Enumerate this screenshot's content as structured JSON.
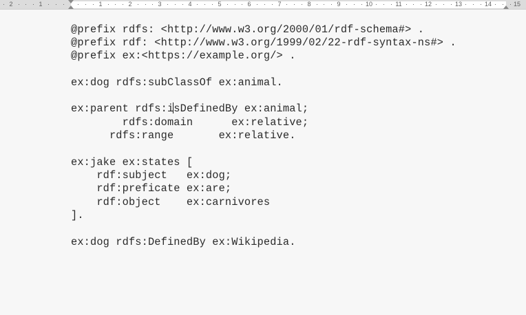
{
  "ruler": {
    "labels": [
      "2",
      "1",
      "1",
      "2",
      "3",
      "4",
      "5",
      "6",
      "7",
      "8",
      "9",
      "10",
      "11",
      "12",
      "13",
      "14",
      "15"
    ]
  },
  "document": {
    "lines": [
      "@prefix rdfs: <http://www.w3.org/2000/01/rdf-schema#> .",
      "@prefix rdf: <http://www.w3.org/1999/02/22-rdf-syntax-ns#> .",
      "@prefix ex:<https://example.org/> .",
      "",
      "ex:dog rdfs:subClassOf ex:animal.",
      "",
      "ex:parent rdfs:i",
      "        rdfs:domain      ex:relative;",
      "      rdfs:range       ex:relative.",
      "",
      "ex:jake ex:states [",
      "    rdf:subject   ex:dog;",
      "    rdf:preficate ex:are;",
      "    rdf:object    ex:carnivores",
      "].",
      "",
      "ex:dog rdfs:DefinedBy ex:Wikipedia."
    ],
    "caret_line_tail": "sDefinedBy ex:animal;"
  }
}
